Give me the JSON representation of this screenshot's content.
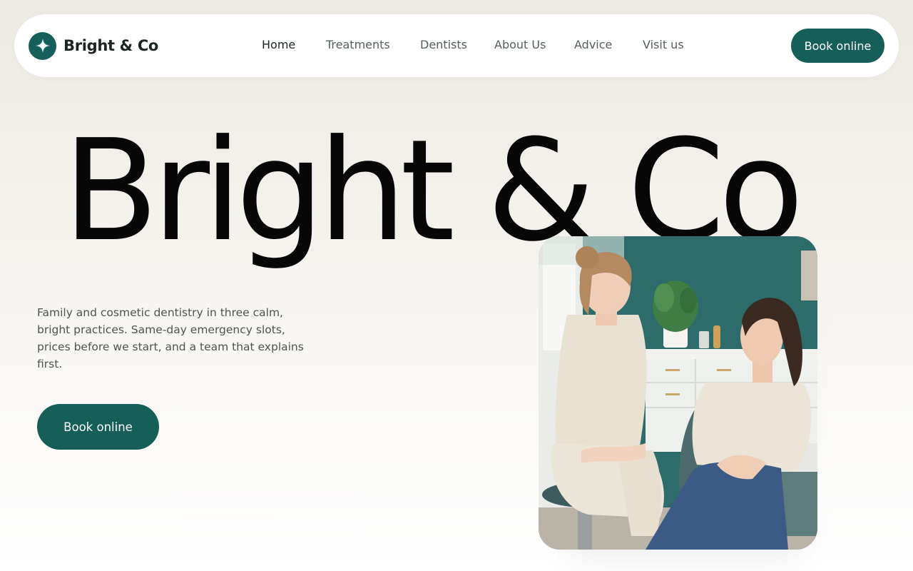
{
  "brand": {
    "name": "Bright & Co",
    "logo_icon": "sparkle-icon"
  },
  "nav": {
    "links": [
      "Home",
      "Treatments",
      "Dentists",
      "About Us",
      "Advice",
      "Visit us"
    ],
    "active": "Home",
    "cta_label": "Book online"
  },
  "hero": {
    "title": "Bright & Co",
    "description": "Family and cosmetic dentistry in three calm, bright practices. Same-day emergency slots, prices before we start, and a team that explains first.",
    "cta_label": "Book online"
  },
  "colors": {
    "accent": "#165e58",
    "wall": "#2b6b69",
    "background": "#f1ede7"
  }
}
